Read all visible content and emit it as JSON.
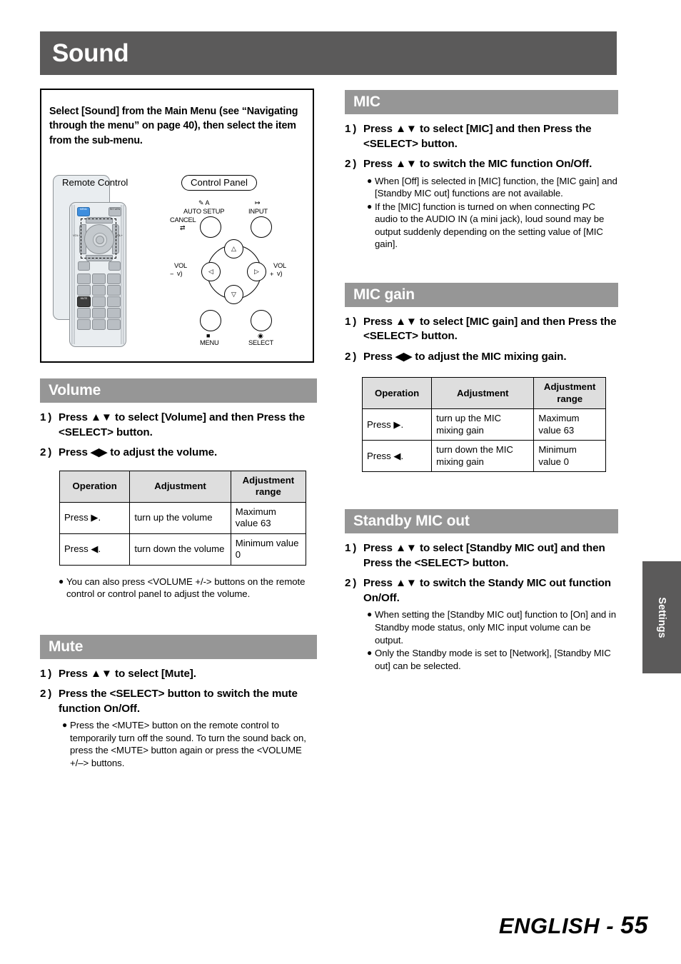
{
  "page": {
    "title": "Sound",
    "footer_prefix": "ENGLISH - ",
    "footer_page": "55",
    "side_tab_label": "Settings"
  },
  "intro": {
    "text": "Select [Sound] from the Main Menu (see “Navigating through the menu” on page 40), then select the item from the sub-menu.",
    "remote_label": "Remote Control",
    "panel_label": "Control Panel",
    "remote_buttons": {
      "menu": "MENU",
      "return": "RETURN",
      "vol_minus": "VOL−",
      "vol_plus": "VOL+",
      "enter": "ENTER",
      "mute": "MUTE"
    },
    "control_panel": {
      "auto_setup": "AUTO SETUP",
      "auto_setup_icon": "✎ A",
      "input": "INPUT",
      "input_icon": "↦",
      "cancel": "CANCEL",
      "cancel_icon": "⇄",
      "vol": "VOL",
      "vol_minus_sign": "−",
      "vol_plus_sign": "+",
      "speaker_icon": "ᴠ)",
      "menu": "MENU",
      "menu_icon": "■",
      "select": "SELECT",
      "select_icon": "◉",
      "arrow_up": "△",
      "arrow_down": "▽",
      "arrow_left": "◁",
      "arrow_right": "▷"
    }
  },
  "sections": {
    "volume": {
      "heading": "Volume",
      "steps": [
        {
          "num": "1 )",
          "text": "Press ▲▼ to select [Volume] and then Press the <SELECT> button."
        },
        {
          "num": "2 )",
          "text": "Press ◀▶ to adjust the volume."
        }
      ],
      "table": {
        "headers": [
          "Operation",
          "Adjustment",
          "Adjustment range"
        ],
        "rows": [
          [
            "Press ▶.",
            "turn up the volume",
            "Maximum value 63"
          ],
          [
            "Press ◀.",
            "turn down the volume",
            "Minimum value 0"
          ]
        ]
      },
      "notes": [
        "You can also press <VOLUME +/-> buttons on the remote control or control panel to adjust the volume."
      ]
    },
    "mute": {
      "heading": "Mute",
      "steps": [
        {
          "num": "1 )",
          "text": "Press ▲▼ to select [Mute]."
        },
        {
          "num": "2 )",
          "text": "Press the <SELECT> button to switch the mute function On/Off."
        }
      ],
      "notes": [
        "Press the <MUTE> button on the remote control to temporarily turn off the sound. To turn the sound back on, press the <MUTE> button again or press the <VOLUME +/–> buttons."
      ]
    },
    "mic": {
      "heading": "MIC",
      "steps": [
        {
          "num": "1 )",
          "text": "Press ▲▼ to select [MIC] and then Press the <SELECT> button."
        },
        {
          "num": "2 )",
          "text": "Press ▲▼ to switch the MIC function On/Off."
        }
      ],
      "notes": [
        "When [Off] is selected in [MIC] function, the [MIC gain] and [Standby MIC out] functions are not available.",
        "If the [MIC] function is turned on when connecting PC audio to the AUDIO IN (a mini jack), loud sound may be output suddenly depending on the setting value of [MIC gain]."
      ]
    },
    "mic_gain": {
      "heading": "MIC gain",
      "steps": [
        {
          "num": "1 )",
          "text": "Press ▲▼ to select [MIC gain] and then Press the <SELECT> button."
        },
        {
          "num": "2 )",
          "text": "Press ◀▶ to adjust the MIC mixing gain."
        }
      ],
      "table": {
        "headers": [
          "Operation",
          "Adjustment",
          "Adjustment range"
        ],
        "rows": [
          [
            "Press ▶.",
            "turn up the MIC mixing gain",
            "Maximum value 63"
          ],
          [
            "Press ◀.",
            "turn down the MIC mixing gain",
            "Minimum value 0"
          ]
        ]
      }
    },
    "standby_mic_out": {
      "heading": "Standby MIC out",
      "steps": [
        {
          "num": "1 )",
          "text": "Press ▲▼ to select [Standby MIC out] and then Press the <SELECT> button."
        },
        {
          "num": "2 )",
          "text": "Press ▲▼ to switch the Standy MIC out function On/Off."
        }
      ],
      "notes": [
        "When setting the [Standby MIC out] function to [On] and in Standby mode status, only MIC input volume can be output.",
        "Only the Standby mode is set to [Network], [Standby MIC out] can be selected."
      ]
    }
  },
  "colors": {
    "title_bar": "#5b5a5a",
    "section_bar": "#969696",
    "table_header": "#dedede"
  }
}
